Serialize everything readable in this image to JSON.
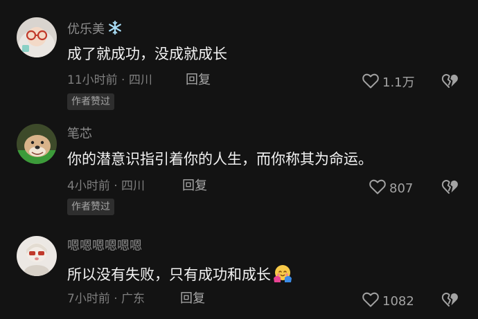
{
  "comments": [
    {
      "username": "优乐美",
      "username_emoji": "snowflake",
      "text": "成了就成功，没成就成长",
      "meta": "11小时前 · 四川",
      "reply_label": "回复",
      "likes": "1.1万",
      "badge": "作者赞过"
    },
    {
      "username": "笔芯",
      "text": "你的潜意识指引着你的人生，而你称其为命运。",
      "meta": "4小时前 · 四川",
      "reply_label": "回复",
      "likes": "807",
      "badge": "作者赞过"
    },
    {
      "username": "嗯嗯嗯嗯嗯嗯",
      "text": "所以没有失败，只有成功和成长",
      "text_emoji": "hugging-face",
      "meta": "7小时前 · 广东",
      "reply_label": "回复",
      "likes": "1082"
    }
  ],
  "icons": {
    "like": "heart-outline-icon",
    "dislike": "broken-heart-icon"
  },
  "colors": {
    "background": "#131313",
    "username": "#8d8d8d",
    "text": "#f2f2f2",
    "meta": "#7f7f7f",
    "badge_bg": "#2e2e2e"
  }
}
